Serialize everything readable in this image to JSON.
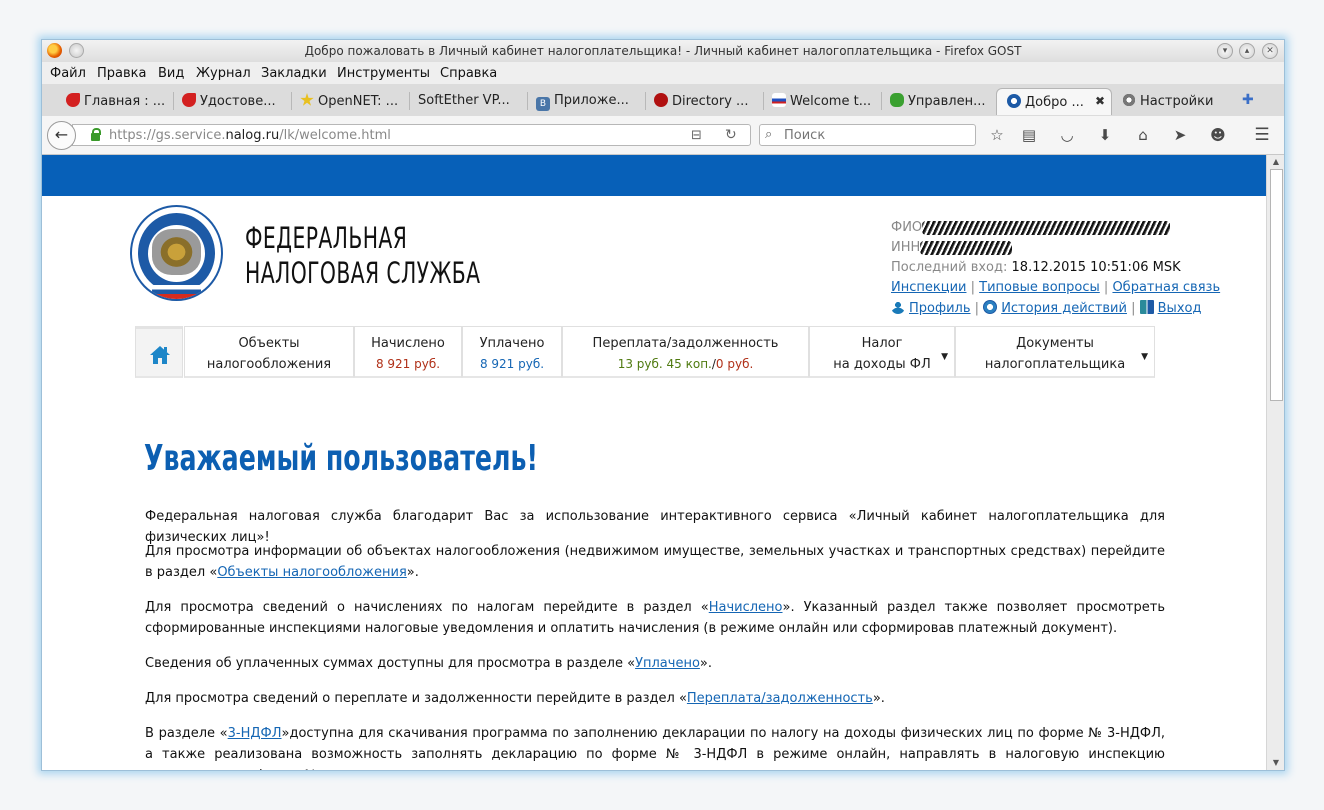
{
  "window": {
    "title": "Добро пожаловать в Личный кабинет налогоплательщика! - Личный кабинет налогоплательщика - Firefox GOST"
  },
  "menu": [
    "Файл",
    "Правка",
    "Вид",
    "Журнал",
    "Закладки",
    "Инструменты",
    "Справка"
  ],
  "tabs": [
    {
      "label": "Главная : ...",
      "icon_color": "#d32020"
    },
    {
      "label": "Удостове...",
      "icon_color": "#d32020"
    },
    {
      "label": "OpenNET: ...",
      "icon_color": "#e8c020"
    },
    {
      "label": "SoftEther VP...",
      "icon_color": ""
    },
    {
      "label": "Приложе...",
      "icon_color": "#4a76a8"
    },
    {
      "label": "Directory ...",
      "icon_color": "#b01010"
    },
    {
      "label": "Welcome t...",
      "icon_color": "#2050c0"
    },
    {
      "label": "Управлен...",
      "icon_color": "#3aa030"
    },
    {
      "label": "Добро ...",
      "icon_color": "#1d5aa6",
      "active": true
    },
    {
      "label": "Настройки",
      "icon_color": "#777777"
    }
  ],
  "tab_close_glyph": "✖",
  "new_tab_glyph": "✚",
  "url": {
    "pre": "https://gs.service.",
    "host": "nalog.ru",
    "post": "/lk/welcome.html"
  },
  "search": {
    "placeholder": "Поиск"
  },
  "brand": {
    "line1": "ФЕДЕРАЛЬНАЯ",
    "line2": "НАЛОГОВАЯ СЛУЖБА"
  },
  "user": {
    "fio_label": "ФИО",
    "inn_label": "ИНН",
    "last_login_label": "Последний вход:",
    "last_login_value": "18.12.2015 10:51:06 MSK"
  },
  "links_row1": [
    "Инспекции",
    "Типовые вопросы",
    "Обратная связь"
  ],
  "links_row2": {
    "profile": "Профиль",
    "history": "История действий",
    "logout": "Выход"
  },
  "link_sep": "|",
  "nav": {
    "objects": {
      "line1": "Объекты",
      "line2": "налогообложения"
    },
    "accrued": {
      "label": "Начислено",
      "amount": "8 921 руб."
    },
    "paid": {
      "label": "Уплачено",
      "amount": "8 921 руб."
    },
    "overpay": {
      "label": "Переплата/задолженность",
      "over": "13 руб. 45 коп.",
      "slash": "/",
      "debt": "0 руб."
    },
    "tax": {
      "line1": "Налог",
      "line2": "на доходы ФЛ"
    },
    "docs": {
      "line1": "Документы",
      "line2": "налогоплательщика"
    }
  },
  "heading": "Уважаемый пользователь!",
  "paragraphs": {
    "p1": "Федеральная налоговая служба благодарит Вас за использование интерактивного сервиса «Личный кабинет налогоплательщика для физических лиц»!",
    "p2_pre": "Для просмотра информации об объектах налогообложения (недвижимом имуществе, земельных участках и транспортных средствах) перейдите в раздел «",
    "p2_link": "Объекты налогообложения",
    "p2_post": "».",
    "p3_pre": "Для просмотра сведений о начислениях по налогам перейдите в раздел «",
    "p3_link": "Начислено",
    "p3_post": "». Указанный раздел также позволяет просмотреть сформированные инспекциями налоговые уведомления и оплатить начисления (в режиме онлайн или сформировав платежный документ).",
    "p4_pre": "Сведения об уплаченных суммах доступны для просмотра в разделе «",
    "p4_link": "Уплачено",
    "p4_post": "».",
    "p5_pre": "Для просмотра сведений о переплате и задолженности перейдите в раздел «",
    "p5_link": "Переплата/задолженность",
    "p5_post": "».",
    "p6_pre": "В разделе «",
    "p6_link": "3-НДФЛ",
    "p6_post": "»доступна для скачивания программа по заполнению декларации по налогу на доходы физических лиц по форме № 3-НДФЛ, а также реализована возможность заполнять декларацию по форме № 3-НДФЛ в режиме онлайн, направлять в налоговую инспекцию декларацию по форме №"
  },
  "colors": {
    "brand_blue": "#0760b8",
    "heading_blue": "#0c5fb2",
    "link_blue": "#1566b4",
    "red": "#b03018",
    "green": "#4f7a10"
  }
}
